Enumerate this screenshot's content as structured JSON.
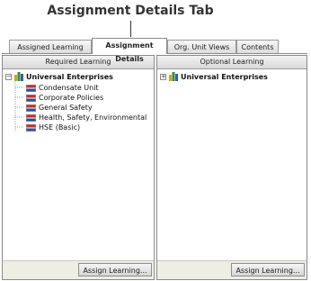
{
  "callout": {
    "title": "Assignment Details Tab"
  },
  "tabs": [
    {
      "label": "Assigned Learning"
    },
    {
      "label": "Assignment Details"
    },
    {
      "label": "Org. Unit Views"
    },
    {
      "label": "Contents"
    }
  ],
  "left_panel": {
    "header": "Required Learning",
    "root": {
      "expander": "−",
      "label": "Universal Enterprises"
    },
    "items": [
      {
        "label": "Condensate Unit"
      },
      {
        "label": "Corporate Policies"
      },
      {
        "label": "General Safety"
      },
      {
        "label": "Health, Safety, Environmental"
      },
      {
        "label": "HSE (Basic)"
      }
    ],
    "button": "Assign Learning..."
  },
  "right_panel": {
    "header": "Optional Learning",
    "root": {
      "expander": "+",
      "label": "Universal Enterprises"
    },
    "button": "Assign Learning..."
  },
  "colors": {
    "footer": "#efeee2",
    "border": "#8a8a8a",
    "flag_red": "#c03030",
    "flag_blue": "#2f4fa0"
  }
}
